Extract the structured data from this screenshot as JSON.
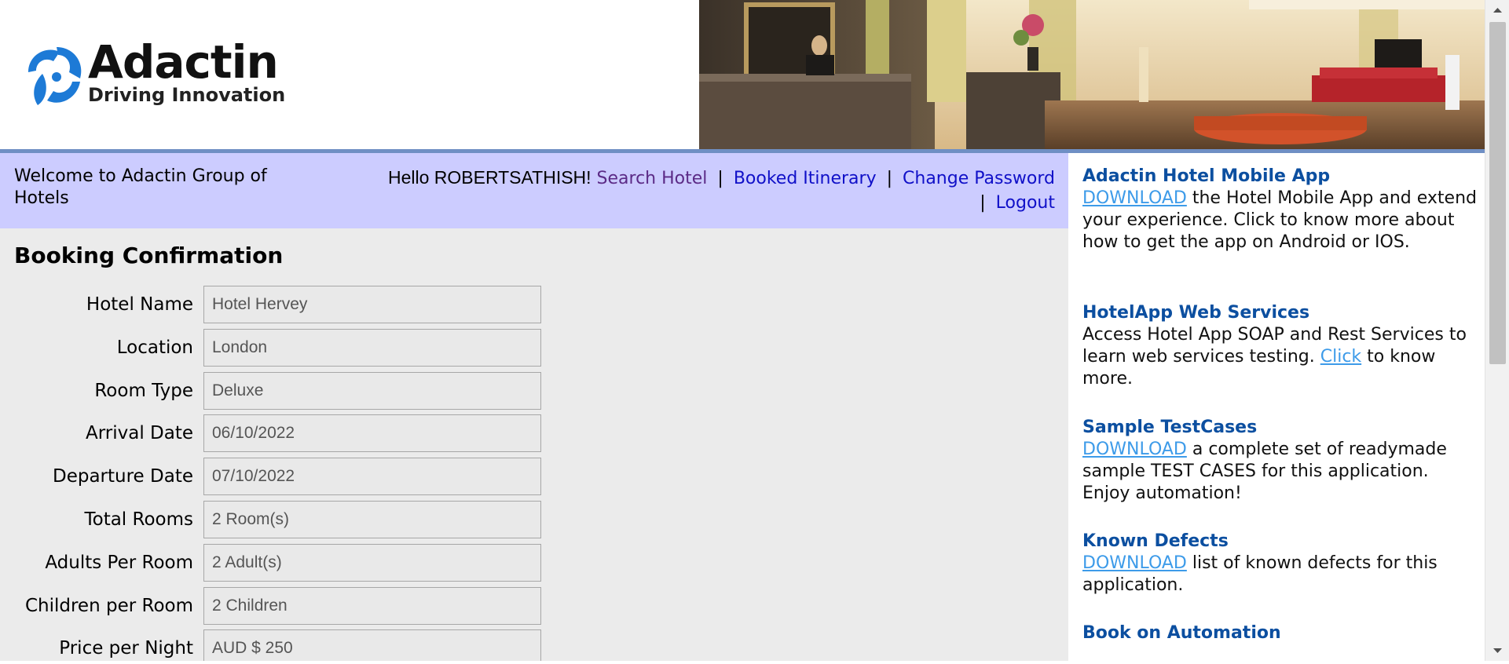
{
  "header": {
    "logo_name": "Adactin",
    "logo_tagline": "Driving Innovation",
    "colors": {
      "rule": "#6f8fc4",
      "logo_blue": "#1d7ad6"
    }
  },
  "nav": {
    "welcome": "Welcome to Adactin Group of Hotels",
    "hello": "Hello ROBERTSATHISH!",
    "links": {
      "search_hotel": "Search Hotel",
      "booked_itinerary": "Booked Itinerary",
      "change_password": "Change Password",
      "logout": "Logout"
    },
    "separator": "|",
    "colors": {
      "background": "#ccccff",
      "link": "#1010c8",
      "visited": "#5b2a86"
    }
  },
  "main": {
    "title": "Booking Confirmation",
    "fields": [
      {
        "label": "Hotel Name",
        "value": "Hotel Hervey"
      },
      {
        "label": "Location",
        "value": "London"
      },
      {
        "label": "Room Type",
        "value": "Deluxe"
      },
      {
        "label": "Arrival Date",
        "value": "06/10/2022"
      },
      {
        "label": "Departure Date",
        "value": "07/10/2022"
      },
      {
        "label": "Total Rooms",
        "value": "2 Room(s)"
      },
      {
        "label": "Adults Per Room",
        "value": "2 Adult(s)"
      },
      {
        "label": "Children per Room",
        "value": "2 Children"
      },
      {
        "label": "Price per Night",
        "value": "AUD $ 250"
      }
    ]
  },
  "sidebar": {
    "mobile_app": {
      "heading": "Adactin Hotel Mobile App",
      "link": "DOWNLOAD",
      "text": " the Hotel Mobile App and extend your experience. Click to know more about how to get the app on Android or IOS."
    },
    "web_services": {
      "heading": "HotelApp Web Services",
      "text_before": "Access Hotel App SOAP and Rest Services to learn web services testing. ",
      "link": "Click",
      "text_after": " to know more."
    },
    "test_cases": {
      "heading": "Sample TestCases",
      "link": "DOWNLOAD",
      "text": " a complete set of readymade sample TEST CASES for this application. Enjoy automation!"
    },
    "known_defects": {
      "heading": "Known Defects",
      "link": "DOWNLOAD",
      "text": " list of known defects for this application."
    },
    "book": {
      "heading": "Book on Automation"
    }
  },
  "icons": {
    "logo": "adactin-swirl-logo",
    "banner": "hotel-lobby-photo",
    "scroll_up": "triangle-up-icon",
    "scroll_down": "triangle-down-icon"
  }
}
